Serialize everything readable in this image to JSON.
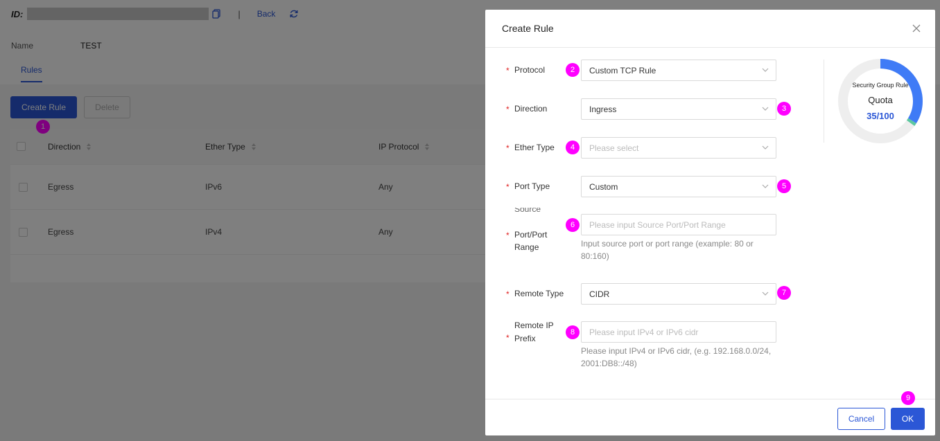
{
  "header": {
    "id_label": "ID:",
    "separator": "|",
    "back_label": "Back"
  },
  "details": {
    "name_label": "Name",
    "name_value": "TEST"
  },
  "tabs": [
    {
      "label": "Rules"
    }
  ],
  "toolbar": {
    "create_label": "Create Rule",
    "delete_label": "Delete"
  },
  "table": {
    "columns": [
      "Direction",
      "Ether Type",
      "IP Protocol"
    ],
    "rows": [
      {
        "direction": "Egress",
        "ether_type": "IPv6",
        "ip_protocol": "Any"
      },
      {
        "direction": "Egress",
        "ether_type": "IPv4",
        "ip_protocol": "Any"
      }
    ]
  },
  "modal": {
    "title": "Create Rule",
    "required_mark": "*",
    "fields": {
      "protocol": {
        "label": "Protocol",
        "value": "Custom TCP Rule"
      },
      "direction": {
        "label": "Direction",
        "value": "Ingress"
      },
      "ether_type": {
        "label": "Ether Type",
        "placeholder": "Please select"
      },
      "port_type": {
        "label": "Port Type",
        "value": "Custom"
      },
      "source_port": {
        "label_line1": "Source",
        "label_line2": "Port/Port",
        "label_line3": "Range",
        "placeholder": "Please input Source Port/Port Range",
        "hint": "Input source port or port range (example: 80 or 80:160)"
      },
      "remote_type": {
        "label": "Remote Type",
        "value": "CIDR"
      },
      "remote_ip_prefix": {
        "label_line1": "Remote IP",
        "label_line2": "Prefix",
        "placeholder": "Please input IPv4 or IPv6 cidr",
        "hint": "Please input IPv4 or IPv6 cidr, (e.g. 192.168.0.0/24, 2001:DB8::/48)"
      }
    },
    "quota": {
      "title": "Security Group Rule",
      "label": "Quota",
      "value": "35/100",
      "used": 35,
      "total": 100
    },
    "cancel_label": "Cancel",
    "ok_label": "OK"
  },
  "annotations": [
    "1",
    "2",
    "3",
    "4",
    "5",
    "6",
    "7",
    "8",
    "9"
  ],
  "colors": {
    "primary": "#2b57d6",
    "badge": "#ff00ff",
    "required": "#e02424",
    "quota_ring": "#3f7bf6",
    "quota_tail": "#5cc8a0"
  }
}
